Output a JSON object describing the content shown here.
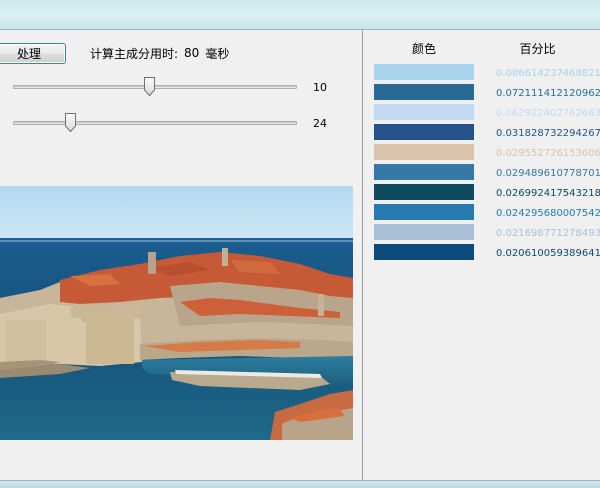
{
  "controls": {
    "process_button_label": "处理",
    "time_prefix": "计算主成分用时:",
    "time_value": "80",
    "time_unit": "毫秒"
  },
  "sliders": [
    {
      "value": "10",
      "fraction": 0.48
    },
    {
      "value": "24",
      "fraction": 0.19
    }
  ],
  "panel": {
    "color_header": "颜色",
    "percent_header": "百分比",
    "rows": [
      {
        "color": "#a7d4ec",
        "percent": "0.0866142374688219",
        "percent_color": "#a7d4ec"
      },
      {
        "color": "#2a6b96",
        "percent": "0.0721114121209621",
        "percent_color": "#2a6b96"
      },
      {
        "color": "#c2d9ef",
        "percent": "0.0629224027626633",
        "percent_color": "#c2d9ef"
      },
      {
        "color": "#24528a",
        "percent": "0.0318287322942677",
        "percent_color": "#24528a"
      },
      {
        "color": "#dbc3ab",
        "percent": "0.0295527261536063",
        "percent_color": "#dbc3ab"
      },
      {
        "color": "#3479a6",
        "percent": "0.029489610778701",
        "percent_color": "#3479a6"
      },
      {
        "color": "#0d4a5e",
        "percent": "0.0269924175432187",
        "percent_color": "#0d4a5e"
      },
      {
        "color": "#277ab0",
        "percent": "0.0242956800075421",
        "percent_color": "#277ab0"
      },
      {
        "color": "#aac0d8",
        "percent": "0.0216987712784931",
        "percent_color": "#aac0d8"
      },
      {
        "color": "#0d4a7c",
        "percent": "0.0206100593896415",
        "percent_color": "#0d4a7c"
      }
    ]
  }
}
